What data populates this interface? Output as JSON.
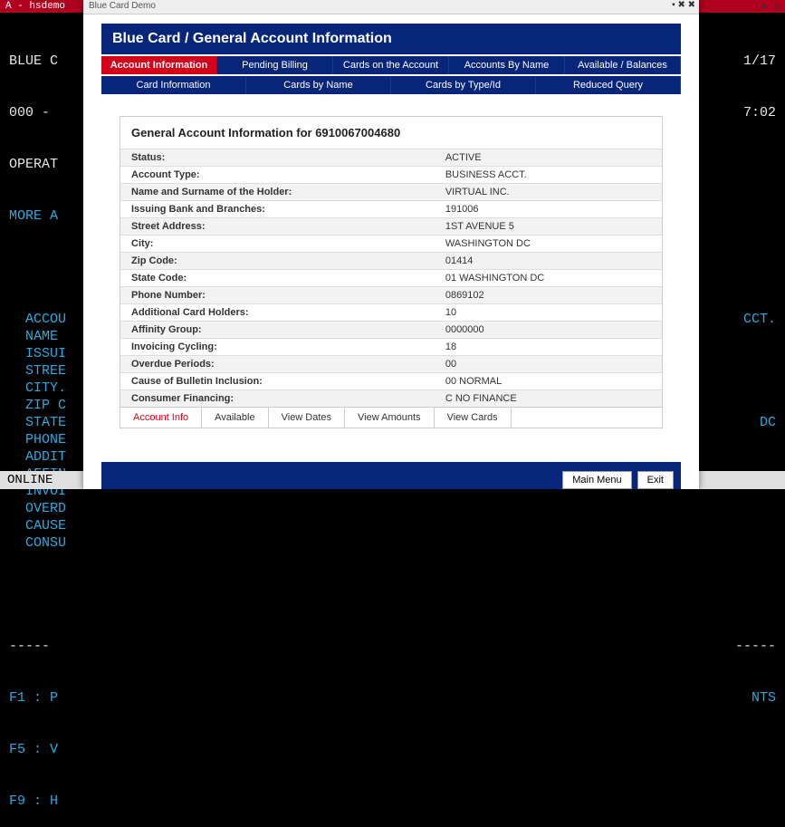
{
  "term_header": "A - hsdemo",
  "terminal": {
    "l1_left": "BLUE C",
    "l1_right": "1/17",
    "l2_left": "000 -",
    "l2_right": "7:02",
    "l3": "OPERAT",
    "l4": "MORE A",
    "fields": [
      {
        "label": "ACCOU",
        "rval": "CCT."
      },
      {
        "label": "NAME",
        "rval": ""
      },
      {
        "label": "ISSUI",
        "rval": ""
      },
      {
        "label": "STREE",
        "rval": ""
      },
      {
        "label": "CITY.",
        "rval": ""
      },
      {
        "label": "ZIP C",
        "rval": ""
      },
      {
        "label": "STATE",
        "rval": "DC"
      },
      {
        "label": "PHONE",
        "rval": ""
      },
      {
        "label": "ADDIT",
        "rval": ""
      },
      {
        "label": "AFFIN",
        "rval": ""
      },
      {
        "label": "INVOI",
        "rval": ""
      },
      {
        "label": "OVERD",
        "rval": ""
      },
      {
        "label": "CAUSE",
        "rval": ""
      },
      {
        "label": "CONSU",
        "rval": ""
      }
    ],
    "dashes_left": "-----",
    "dashes_right": "-----",
    "fn1": "F1 : P",
    "fn1_right": "NTS",
    "fn5": "F5 : V",
    "fn9": "F9 : H",
    "status": "ONLINE"
  },
  "app": {
    "title": "Blue Card Demo",
    "banner": "Blue Card / General Account Information",
    "tabs_row1": [
      {
        "label": "Account Information",
        "active": true
      },
      {
        "label": "Pending Billing"
      },
      {
        "label": "Cards on the Account"
      },
      {
        "label": "Accounts By Name"
      },
      {
        "label": "Available / Balances"
      }
    ],
    "tabs_row2": [
      {
        "label": "Card Information"
      },
      {
        "label": "Cards by Name"
      },
      {
        "label": "Cards by Type/Id"
      },
      {
        "label": "Reduced Query"
      }
    ],
    "content_title": "General Account Information for 6910067004680",
    "rows": [
      {
        "key": "Status:",
        "val": "ACTIVE"
      },
      {
        "key": "Account Type:",
        "val": "BUSINESS ACCT."
      },
      {
        "key": "Name and Surname of the Holder:",
        "val": "VIRTUAL INC."
      },
      {
        "key": "Issuing Bank and Branches:",
        "val": "191006"
      },
      {
        "key": "Street Address:",
        "val": "1ST AVENUE 5"
      },
      {
        "key": "City:",
        "val": "WASHINGTON DC"
      },
      {
        "key": "Zip Code:",
        "val": "01414"
      },
      {
        "key": "State Code:",
        "val": "01 WASHINGTON DC"
      },
      {
        "key": "Phone Number:",
        "val": "0869102"
      },
      {
        "key": "Additional Card Holders:",
        "val": "10"
      },
      {
        "key": "Affinity Group:",
        "val": "0000000"
      },
      {
        "key": "Invoicing Cycling:",
        "val": "18"
      },
      {
        "key": "Overdue Periods:",
        "val": "00"
      },
      {
        "key": "Cause of Bulletin Inclusion:",
        "val": "00 NORMAL"
      },
      {
        "key": "Consumer Financing:",
        "val": "C NO FINANCE"
      }
    ],
    "bottom_tabs": [
      {
        "label": "Account Info",
        "active": true
      },
      {
        "label": "Available"
      },
      {
        "label": "View Dates"
      },
      {
        "label": "View Amounts"
      },
      {
        "label": "View Cards"
      }
    ],
    "footer": {
      "main_menu": "Main Menu",
      "exit": "Exit"
    }
  }
}
